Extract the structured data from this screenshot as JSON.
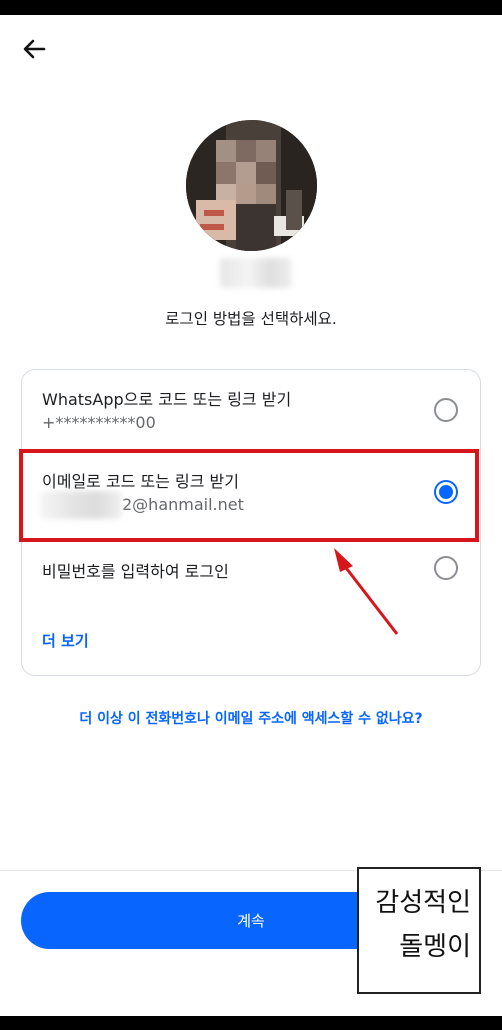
{
  "header": {
    "back_icon": "arrow-left-icon"
  },
  "profile": {
    "avatar_icon": "profile-photo",
    "name": ""
  },
  "prompt": "로그인 방법을 선택하세요.",
  "options": [
    {
      "title": "WhatsApp으로 코드 또는 링크 받기",
      "subtitle": "+**********00",
      "selected": false
    },
    {
      "title": "이메일로 코드 또는 링크 받기",
      "subtitle": "2@hanmail.net",
      "selected": true
    },
    {
      "title": "비밀번호를 입력하여 로그인",
      "subtitle": "",
      "selected": false
    }
  ],
  "more_label": "더 보기",
  "access_link": "더 이상 이 전화번호나 이메일 주소에 액세스할 수 없나요?",
  "continue_label": "계속",
  "watermark": {
    "line1": "감성적인",
    "line2": "돌멩이"
  },
  "colors": {
    "accent": "#0866ff",
    "highlight": "#d7161c"
  }
}
